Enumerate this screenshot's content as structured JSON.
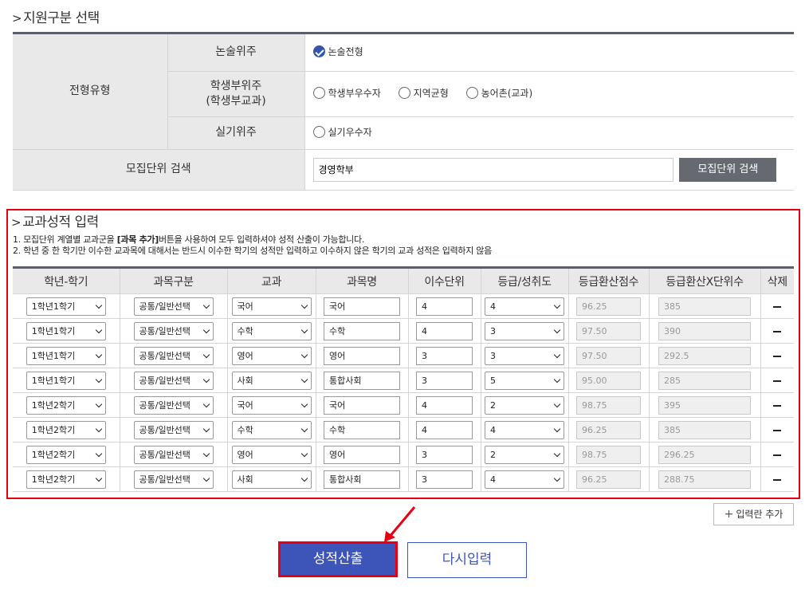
{
  "section1": {
    "title": "지원구분 선택",
    "type_label": "전형유형",
    "rows": [
      {
        "label": "논술위주",
        "options": [
          {
            "label": "논술전형",
            "checked": true
          }
        ]
      },
      {
        "label_line1": "학생부위주",
        "label_line2": "(학생부교과)",
        "options": [
          {
            "label": "학생부우수자",
            "checked": false
          },
          {
            "label": "지역균형",
            "checked": false
          },
          {
            "label": "농어촌(교과)",
            "checked": false
          }
        ]
      },
      {
        "label": "실기위주",
        "options": [
          {
            "label": "실기우수자",
            "checked": false
          }
        ]
      }
    ],
    "search_label": "모집단위 검색",
    "search_value": "경영학부",
    "search_button": "모집단위 검색"
  },
  "section2": {
    "title": "교과성적 입력",
    "note1_pre": "1. 모집단위 계열별 교과군을 ",
    "note1_bold": "[과목 추가]",
    "note1_post": "버튼을 사용하여 모두 입력하셔야 성적 산출이 가능합니다.",
    "note2": "2. 학년 중 한 학기만 이수한 교과목에 대해서는 반드시 이수한 학기의 성적만 입력하고 이수하지 않은 학기의 교과 성적은 입력하지 않음",
    "headers": [
      "학년-학기",
      "과목구분",
      "교과",
      "과목명",
      "이수단위",
      "등급/성취도",
      "등급환산점수",
      "등급환산X단위수",
      "삭제"
    ],
    "rows": [
      {
        "term": "1학년1학기",
        "category": "공통/일반선택",
        "subject": "국어",
        "course": "국어",
        "units": "4",
        "grade": "4",
        "score": "96.25",
        "weighted": "385"
      },
      {
        "term": "1학년1학기",
        "category": "공통/일반선택",
        "subject": "수학",
        "course": "수학",
        "units": "4",
        "grade": "3",
        "score": "97.50",
        "weighted": "390"
      },
      {
        "term": "1학년1학기",
        "category": "공통/일반선택",
        "subject": "영어",
        "course": "영어",
        "units": "3",
        "grade": "3",
        "score": "97.50",
        "weighted": "292.5"
      },
      {
        "term": "1학년1학기",
        "category": "공통/일반선택",
        "subject": "사회",
        "course": "통합사회",
        "units": "3",
        "grade": "5",
        "score": "95.00",
        "weighted": "285"
      },
      {
        "term": "1학년2학기",
        "category": "공통/일반선택",
        "subject": "국어",
        "course": "국어",
        "units": "4",
        "grade": "2",
        "score": "98.75",
        "weighted": "395"
      },
      {
        "term": "1학년2학기",
        "category": "공통/일반선택",
        "subject": "수학",
        "course": "수학",
        "units": "4",
        "grade": "4",
        "score": "96.25",
        "weighted": "385"
      },
      {
        "term": "1학년2학기",
        "category": "공통/일반선택",
        "subject": "영어",
        "course": "영어",
        "units": "3",
        "grade": "2",
        "score": "98.75",
        "weighted": "296.25"
      },
      {
        "term": "1학년2학기",
        "category": "공통/일반선택",
        "subject": "사회",
        "course": "통합사회",
        "units": "3",
        "grade": "4",
        "score": "96.25",
        "weighted": "288.75"
      }
    ]
  },
  "buttons": {
    "add_row": "입력란 추가",
    "calculate": "성적산출",
    "reset": "다시입력"
  },
  "colors": {
    "primary": "#3d55b8",
    "highlight": "#e60012",
    "header_bg": "#e9e9e9",
    "border_dark": "#5a5f6b"
  }
}
